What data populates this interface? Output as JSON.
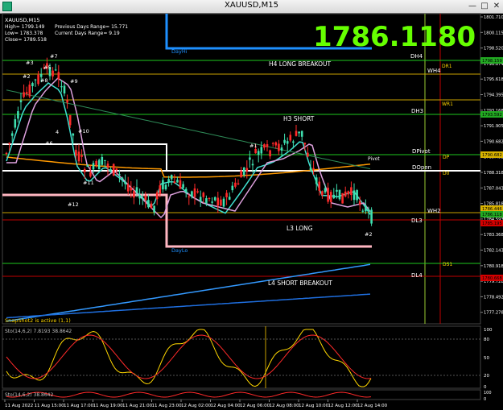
{
  "window": {
    "title": "XAUUSD,M15"
  },
  "info_panel": {
    "symbol": "XAUUSD,M15",
    "high": "High= 1799.149",
    "low": "Low= 1783.378",
    "close": "Close= 1789.518",
    "prev_range": "Previous Days Range= 15.771",
    "curr_range": "Current Days Range= 9.19"
  },
  "big_price": "1786.1180",
  "levels": {
    "dayhi": "DayHi",
    "daylo": "DayLo",
    "h4": "H4 LONG BREAKOUT",
    "h3": "H3 SHORT",
    "l3": "L3 LONG",
    "l4": "L4 SHORT BREAKOUT",
    "dh4": "DH4",
    "dh3": "DH3",
    "dpivot": "DPivot",
    "dopen": "DOpen",
    "dl3": "DL3",
    "dl4": "DL4",
    "wh4": "WH4",
    "wh2": "WH2",
    "dr1": "DR1",
    "wr1": "WR1",
    "dp": "DP",
    "d0": "D0",
    "ds1": "DS1",
    "pivot": "Pivot"
  },
  "wave_labels": {
    "w3": "#3",
    "w5": "#5",
    "w7": "#7",
    "w2": "#2",
    "w8": "#8",
    "w9": "#9",
    "w6": "#6",
    "w4": "4",
    "w10": "#10",
    "w11": "#11",
    "w12": "#12",
    "w1": "#1",
    "w2b": "#2"
  },
  "snapshot": "SnapShot2 is active (1,1)",
  "sub1_label": "Sto(14,6,2) 7.8193 38.8642",
  "sub2_label": "Sto(14,6,2) 38.8642",
  "price_axis": {
    "ticks": [
      "1801.710",
      "1800.115",
      "1798.520",
      "1796.874",
      "1795.618",
      "1794.395",
      "1793.168",
      "1791.905",
      "1790.682",
      "1789.493",
      "1788.318",
      "1787.043",
      "1785.818",
      "1784.593",
      "1783.368",
      "1782.143",
      "1780.918",
      "1779.728",
      "1778.492",
      "1777.278"
    ],
    "badges": [
      {
        "text": "1798.159",
        "color": "#22aa22"
      },
      {
        "text": "1793.592",
        "color": "#22aa22"
      },
      {
        "text": "1790.682",
        "color": "#d9b300"
      },
      {
        "text": "1786.446",
        "color": "#d9b300"
      },
      {
        "text": "1786.118",
        "color": "#22aa22"
      },
      {
        "text": "1785.195",
        "color": "#d40000"
      },
      {
        "text": "1780.668",
        "color": "#d40000"
      }
    ]
  },
  "sub_axis": {
    "ticks": [
      "100",
      "80",
      "50",
      "20",
      "0"
    ],
    "ticks2": [
      "100",
      "0"
    ]
  },
  "time_axis": [
    "11 Aug 2022",
    "11 Aug 15:00",
    "11 Aug 17:00",
    "11 Aug 19:00",
    "11 Aug 21:00",
    "11 Aug 23:00",
    "12 Aug 02:00",
    "12 Aug 04:00",
    "12 Aug 06:00",
    "12 Aug 08:00",
    "12 Aug 10:00",
    "12 Aug 12:00",
    "12 Aug 14:00"
  ],
  "colors": {
    "bull": "#3fe0b0",
    "bear": "#ff2a2a",
    "accent_green": "#66ff00",
    "dayhi_line": "#1e90ff",
    "sto_main": "#ffd700",
    "sto_signal": "#ff2a2a"
  }
}
